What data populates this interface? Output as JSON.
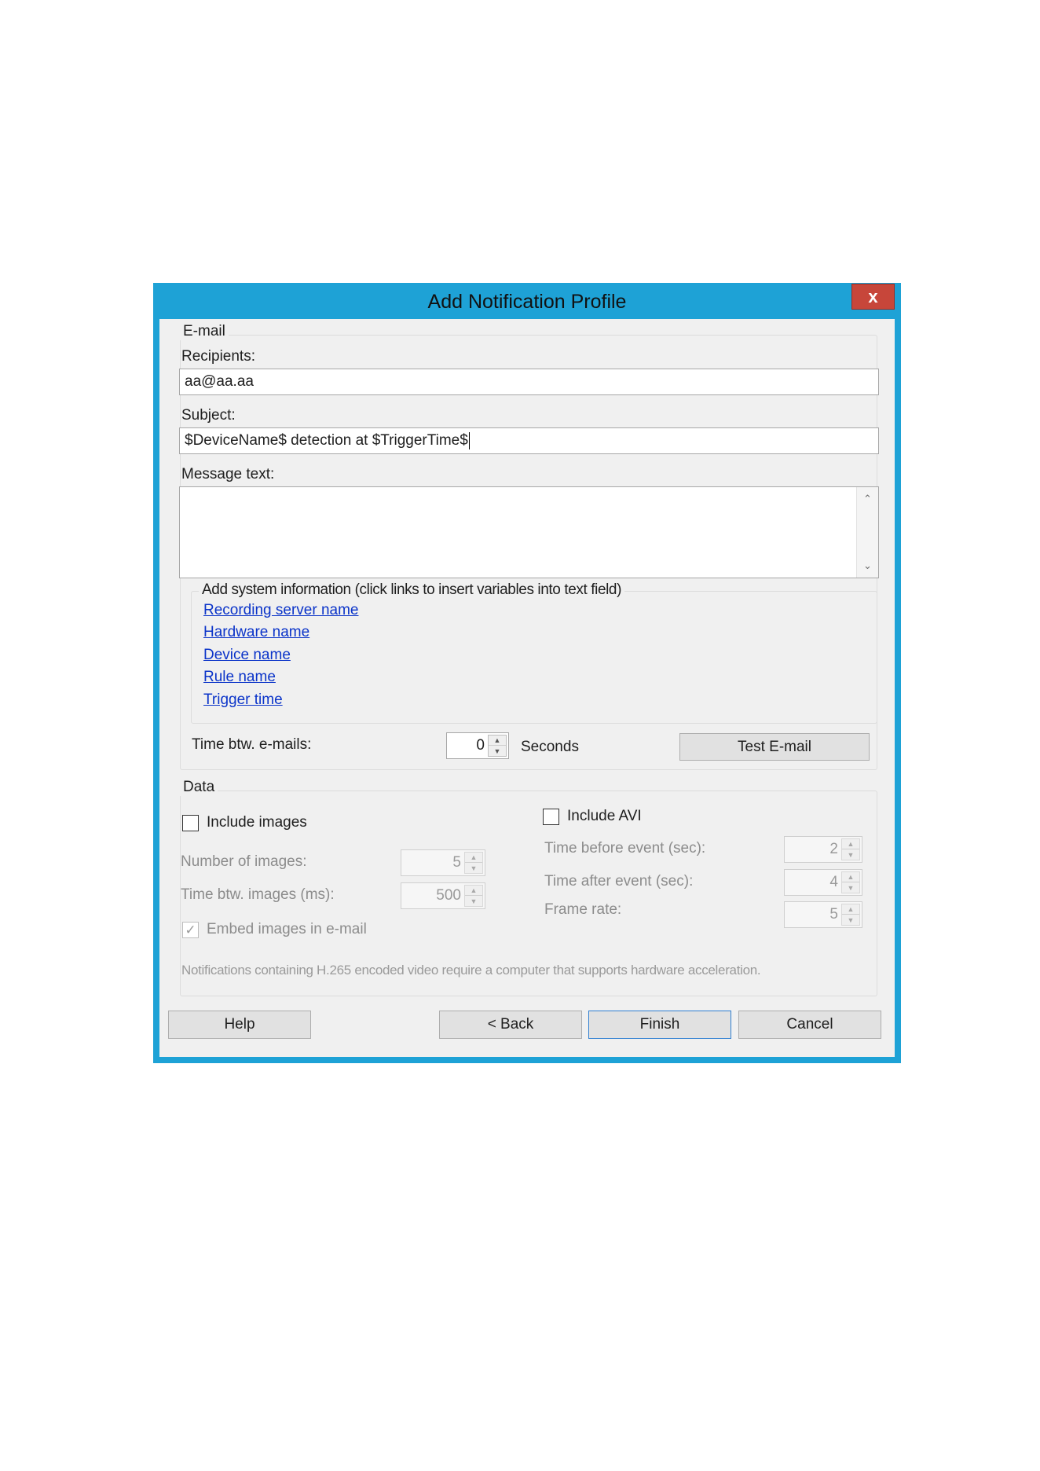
{
  "dialog": {
    "title": "Add Notification Profile",
    "close_glyph": "x"
  },
  "email": {
    "legend": "E-mail",
    "recipients_label": "Recipients:",
    "recipients_value": "aa@aa.aa",
    "subject_label": "Subject:",
    "subject_value": "$DeviceName$ detection at $TriggerTime$",
    "message_label": "Message text:",
    "message_value": "",
    "sysinfo_legend": "Add system information (click links to insert variables into text field)",
    "links": [
      "Recording server name",
      "Hardware name",
      "Device name",
      "Rule name",
      "Trigger time"
    ],
    "time_btw_label": "Time btw. e-mails:",
    "time_btw_value": "0",
    "seconds_label": "Seconds",
    "test_button": "Test E-mail"
  },
  "data": {
    "legend": "Data",
    "include_images_label": "Include images",
    "include_images_checked": false,
    "number_of_images_label": "Number of images:",
    "number_of_images_value": "5",
    "time_btw_images_label": "Time btw. images (ms):",
    "time_btw_images_value": "500",
    "embed_label": "Embed images in e-mail",
    "embed_checked": true,
    "include_avi_label": "Include AVI",
    "include_avi_checked": false,
    "time_before_label": "Time before event (sec):",
    "time_before_value": "2",
    "time_after_label": "Time after event (sec):",
    "time_after_value": "4",
    "frame_rate_label": "Frame rate:",
    "frame_rate_value": "5",
    "note": "Notifications containing H.265 encoded video require a computer that supports hardware acceleration."
  },
  "buttons": {
    "help": "Help",
    "back": "< Back",
    "finish": "Finish",
    "cancel": "Cancel"
  },
  "colors": {
    "title_bar": "#1ea2d6",
    "close_button": "#c7463a",
    "link": "#0b34c9"
  }
}
